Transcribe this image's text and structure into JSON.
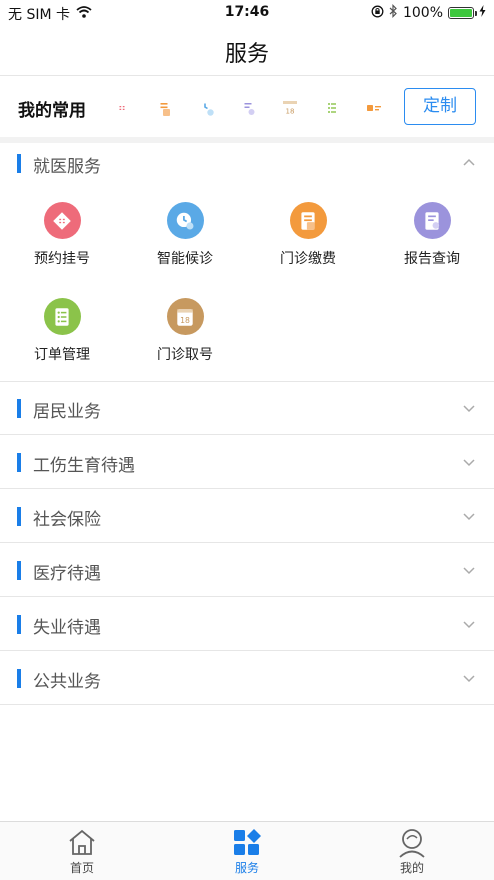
{
  "status_bar": {
    "carrier": "无 SIM 卡",
    "time": "17:46",
    "battery": "100%",
    "battery_level": 1.0
  },
  "nav": {
    "title": "服务"
  },
  "favorites": {
    "label": "我的常用",
    "customize_label": "定制",
    "icons": [
      {
        "name": "registration-icon",
        "color": "#ee6b7a"
      },
      {
        "name": "clinic-payment-icon",
        "color": "#f39a3d"
      },
      {
        "name": "smart-waiting-icon",
        "color": "#5aa9e6"
      },
      {
        "name": "report-query-icon",
        "color": "#9b93dc"
      },
      {
        "name": "ticket-calendar-icon",
        "color": "#c7995f"
      },
      {
        "name": "order-list-icon",
        "color": "#8bc34a"
      },
      {
        "name": "id-card-icon",
        "color": "#f39a3d"
      }
    ]
  },
  "medical_section": {
    "title": "就医服务",
    "items": [
      {
        "label": "预约挂号",
        "icon": "registration-icon",
        "color": "#ee6b7a"
      },
      {
        "label": "智能候诊",
        "icon": "smart-waiting-icon",
        "color": "#5aa9e6"
      },
      {
        "label": "门诊缴费",
        "icon": "clinic-payment-icon",
        "color": "#f39a3d"
      },
      {
        "label": "报告查询",
        "icon": "report-query-icon",
        "color": "#9b93dc"
      },
      {
        "label": "订单管理",
        "icon": "order-list-icon",
        "color": "#8bc34a"
      },
      {
        "label": "门诊取号",
        "icon": "ticket-calendar-icon",
        "color": "#c7995f"
      }
    ]
  },
  "sections": [
    {
      "title": "居民业务"
    },
    {
      "title": "工伤生育待遇"
    },
    {
      "title": "社会保险"
    },
    {
      "title": "医疗待遇"
    },
    {
      "title": "失业待遇"
    },
    {
      "title": "公共业务"
    }
  ],
  "tabs": [
    {
      "label": "首页",
      "icon": "home-icon"
    },
    {
      "label": "服务",
      "icon": "service-grid-icon",
      "active": true
    },
    {
      "label": "我的",
      "icon": "profile-icon"
    }
  ],
  "colors": {
    "accent": "#1a7ee8"
  }
}
